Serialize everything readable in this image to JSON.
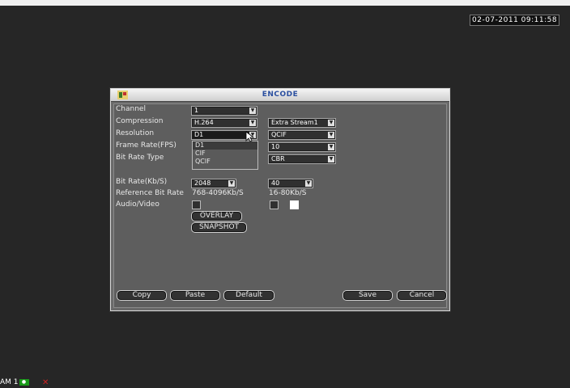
{
  "overlay": {
    "timestamp": "02-07-2011 09:11:58",
    "channel_label": "AM 1"
  },
  "window": {
    "title": "ENCODE"
  },
  "labels": {
    "channel": "Channel",
    "compression": "Compression",
    "resolution": "Resolution",
    "frame_rate": "Frame Rate(FPS)",
    "bit_rate_type": "Bit Rate Type",
    "bit_rate": "Bit Rate(Kb/S)",
    "reference_bit_rate": "Reference Bit Rate",
    "audio_video": "Audio/Video"
  },
  "main_stream": {
    "channel": "1",
    "compression": "H.264",
    "resolution": "D1",
    "bit_rate": "2048",
    "reference_bit_rate": "768-4096Kb/S"
  },
  "resolution_options": [
    "D1",
    "CIF",
    "QCIF"
  ],
  "extra_stream": {
    "stream": "Extra Stream1",
    "resolution": "QCIF",
    "frame_rate": "10",
    "bit_rate_type": "CBR",
    "bit_rate": "40",
    "reference_bit_rate": "16-80Kb/S"
  },
  "buttons": {
    "overlay": "OVERLAY",
    "snapshot": "SNAPSHOT",
    "copy": "Copy",
    "paste": "Paste",
    "default": "Default",
    "save": "Save",
    "cancel": "Cancel"
  },
  "colors": {
    "title_text": "#2a4fa0",
    "window_bg": "#6a6a6a",
    "screen_bg": "#262626"
  }
}
